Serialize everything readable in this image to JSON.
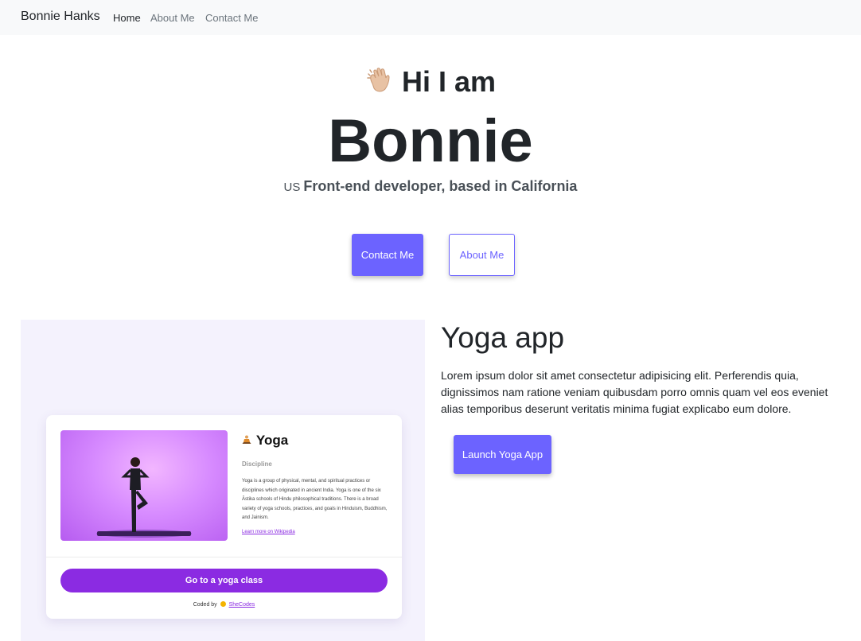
{
  "navbar": {
    "brand": "Bonnie Hanks",
    "links": [
      {
        "label": "Home"
      },
      {
        "label": "About Me"
      },
      {
        "label": "Contact Me"
      }
    ]
  },
  "hero": {
    "greeting": "Hi I am",
    "greeting_icon": "waving-hand-icon",
    "name": "Bonnie",
    "flag_text": "US",
    "tagline": "Front-end developer, based in California",
    "contact_button": "Contact Me",
    "about_button": "About Me"
  },
  "project": {
    "title": "Yoga app",
    "description": "Lorem ipsum dolor sit amet consectetur adipisicing elit. Perferendis quia, dignissimos nam ratione veniam quibusdam porro omnis quam vel eos eveniet alias temporibus deserunt veritatis minima fugiat explicabo eum dolore.",
    "launch_button": "Launch Yoga App",
    "preview": {
      "title": "Yoga",
      "title_icon": "meditation-icon",
      "subtitle": "Discipline",
      "body": "Yoga is a group of physical, mental, and spiritual practices or disciplines which originated in ancient India. Yoga is one of the six Āstika schools of Hindu philosophical traditions. There is a broad variety of yoga schools, practices, and goals in Hinduism, Buddhism, and Jainism.",
      "link": "Learn more on Wikipedia",
      "cta": "Go to a yoga class",
      "credit_prefix": "Coded by",
      "credit_name": "SheCodes"
    }
  },
  "colors": {
    "accent": "#6c63ff",
    "preview_purple": "#8b2be2",
    "navbar_bg": "#f8f9fa",
    "panel_bg": "#f4f2fd"
  }
}
